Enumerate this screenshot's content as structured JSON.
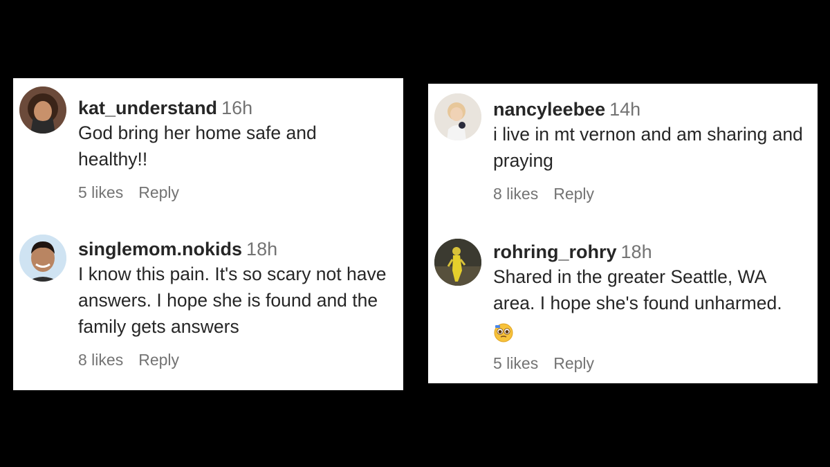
{
  "comments_left": [
    {
      "username": "kat_understand",
      "time": "16h",
      "text": "God bring her home safe and healthy!!",
      "likes": "5 likes",
      "reply": "Reply"
    },
    {
      "username": "singlemom.nokids",
      "time": "18h",
      "text": "I know this pain. It's so scary not have answers. I hope she is found and the family gets answers",
      "likes": "8 likes",
      "reply": "Reply"
    }
  ],
  "comments_right": [
    {
      "username": "nancyleebee",
      "time": "14h",
      "text": "i live in mt vernon and am sharing and praying",
      "likes": "8 likes",
      "reply": "Reply"
    },
    {
      "username": "rohring_rohry",
      "time": "18h",
      "text": "Shared in the greater Seattle, WA area. I hope she's found unharmed.",
      "likes": "5 likes",
      "reply": "Reply"
    }
  ],
  "icons": {
    "emoji": "pleading-face-emoji-icon"
  },
  "colors": {
    "background": "#000000",
    "panel": "#ffffff",
    "username": "#262626",
    "meta": "#737373"
  }
}
